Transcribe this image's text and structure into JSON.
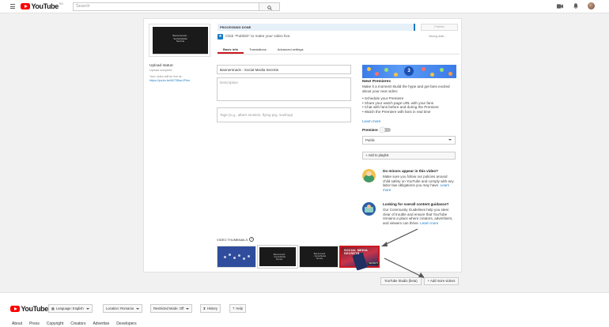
{
  "header": {
    "logo_text": "YouTube",
    "logo_sup": "RO",
    "search_placeholder": "Search"
  },
  "video_panel": {
    "thumb_text": "Bannersnack - Social Media Secrets",
    "upload_status_label": "Upload status:",
    "upload_status_value": "Upload complete",
    "live_at_label": "Your video will be live at:",
    "video_url": "https://youtu.be/6GT6ksr1Pkm"
  },
  "processing": {
    "status": "PROCESSING DONE",
    "publish_label": "Publish",
    "saving": "Saving draft...",
    "hint": "Click \"Publish\" to make your video live."
  },
  "tabs": [
    "Basic info",
    "Translations",
    "Advanced settings"
  ],
  "form": {
    "title_value": "Bannersnack - Social Media Secrets",
    "description_placeholder": "Description",
    "tags_placeholder": "Tags (e.g., albert einstein, flying pig, mashup)"
  },
  "premieres": {
    "banner_number": "3",
    "title": "New! Premieres",
    "description": "Make it a moment! Build the hype and get fans excited about your next video:",
    "bullets": [
      "• Schedule your Premiere",
      "• Share your watch page URL with your fans",
      "• Chat with fans before and during the Premiere",
      "• Watch the Premiere with fans in real time"
    ],
    "learn_more": "Learn more",
    "toggle_label": "Premiere"
  },
  "privacy": {
    "selected": "Public"
  },
  "playlist_button": "+ Add to playlist",
  "minors": {
    "title": "Do minors appear in this video?",
    "body": "Make sure you follow our policies around child safety on YouTube and comply with any labor law obligations you may have.",
    "learn_more": "Learn more"
  },
  "guidance": {
    "title": "Looking for overall content guidance?",
    "body": "Our Community Guidelines help you steer clear of trouble and ensure that YouTube remains a place where creators, advertisers, and viewers can thrive.",
    "learn_more": "Learn more"
  },
  "thumbnails": {
    "label": "VIDEO THUMBNAILS",
    "custom_title": "SOCIAL MEDIA SECRETS",
    "custom_badge": "SECRETS",
    "mini_text": "Bannersnack - Social Media Secrets"
  },
  "bottom_buttons": {
    "studio": "YouTube Studio (beta)",
    "add_more": "+ Add more videos"
  },
  "footer": {
    "logo_text": "YouTube",
    "language": "Language: English",
    "location": "Location: Romania",
    "restricted": "Restricted Mode: Off",
    "history": "History",
    "help": "Help",
    "links": [
      "About",
      "Press",
      "Copyright",
      "Creators",
      "Advertise",
      "Developers"
    ]
  },
  "colors": {
    "brand_red": "#ff0000",
    "link_blue": "#167ac6",
    "active_tab": "#cc181e"
  }
}
